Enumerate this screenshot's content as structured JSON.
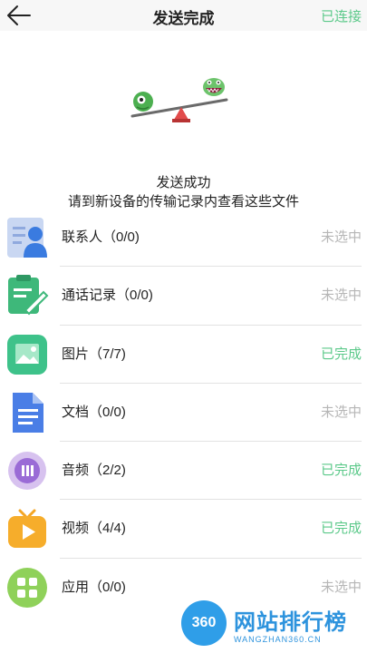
{
  "header": {
    "title": "发送完成",
    "status": "已连接"
  },
  "message": {
    "line1": "发送成功",
    "line2": "请到新设备的传输记录内查看这些文件"
  },
  "items": [
    {
      "label": "联系人（0/0)",
      "status": "未选中",
      "icon": "contacts-icon",
      "done": false
    },
    {
      "label": "通话记录（0/0)",
      "status": "未选中",
      "icon": "call-log-icon",
      "done": false
    },
    {
      "label": "图片（7/7)",
      "status": "已完成",
      "icon": "photo-icon",
      "done": true
    },
    {
      "label": "文档（0/0)",
      "status": "未选中",
      "icon": "document-icon",
      "done": false
    },
    {
      "label": "音频（2/2)",
      "status": "已完成",
      "icon": "audio-icon",
      "done": true
    },
    {
      "label": "视频（4/4)",
      "status": "已完成",
      "icon": "video-icon",
      "done": true
    },
    {
      "label": "应用（0/0)",
      "status": "未选中",
      "icon": "apps-icon",
      "done": false
    }
  ],
  "watermark": {
    "logo": "360",
    "title": "网站排行榜",
    "subtitle": "WANGZHAN360.CN"
  },
  "colors": {
    "accent": "#5cc98a",
    "muted": "#b6b6b6"
  }
}
